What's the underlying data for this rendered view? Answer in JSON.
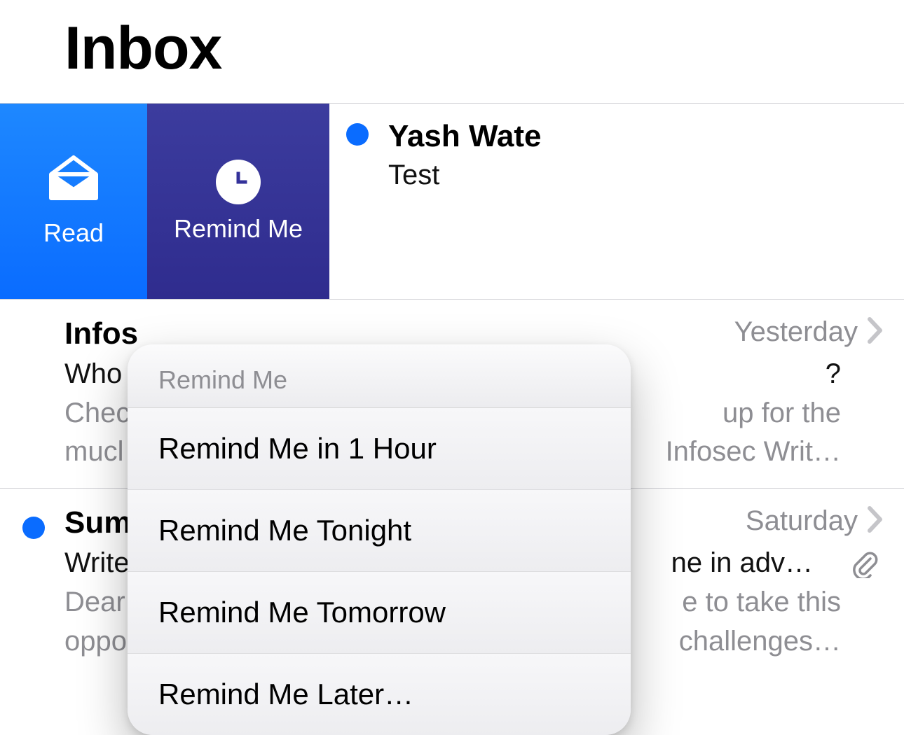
{
  "header": {
    "title": "Inbox"
  },
  "swipe": {
    "read_label": "Read",
    "remind_label": "Remind Me"
  },
  "messages": [
    {
      "sender": "Yash Wate",
      "subject": "Test",
      "unread": true
    },
    {
      "sender": "Infos",
      "subject_left": "Who",
      "subject_right": "?",
      "preview_l1a": "Chec",
      "preview_l1b": "up for the",
      "preview_l2a": "mucl",
      "preview_l2b": "Infosec Writ…",
      "date": "Yesterday",
      "unread": false
    },
    {
      "sender": "Sum",
      "subject_left": "Write",
      "subject_right": "ne in adv…",
      "preview_l1a": "Dear",
      "preview_l1b": "e to take this",
      "preview_l2a": "oppo.",
      "preview_l2b": "challenges…",
      "date": "Saturday",
      "unread": true,
      "has_attachment": true
    }
  ],
  "menu": {
    "title": "Remind Me",
    "options": [
      "Remind Me in 1 Hour",
      "Remind Me Tonight",
      "Remind Me Tomorrow",
      "Remind Me Later…"
    ]
  }
}
